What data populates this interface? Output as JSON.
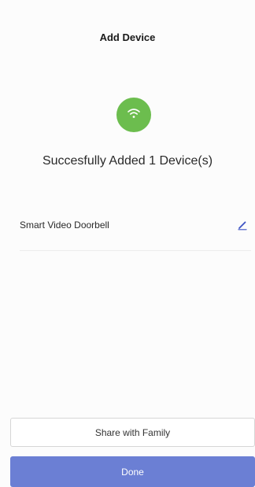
{
  "header": {
    "title": "Add Device"
  },
  "status": {
    "icon": "wifi-icon",
    "badge_color": "#6cbd4e",
    "message": "Succesfully Added 1 Device(s)"
  },
  "devices": [
    {
      "name": "Smart  Video Doorbell",
      "edit_icon": "pencil-icon"
    }
  ],
  "actions": {
    "share_label": "Share with Family",
    "done_label": "Done",
    "done_color": "#6b7fd4"
  }
}
